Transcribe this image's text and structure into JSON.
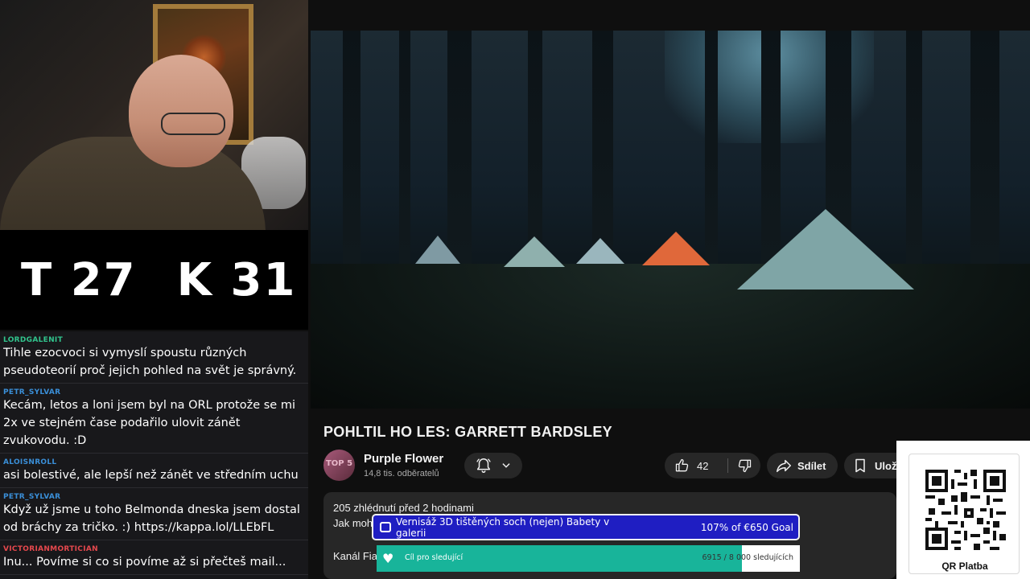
{
  "score": {
    "left": "T 27",
    "right": "K 31"
  },
  "chat": [
    {
      "user": "LORDGALENIT",
      "color": "#31c48d",
      "text": "Tihle ezocvoci si vymyslí spoustu různých pseudoteorií proč jejich pohled na svět je správný."
    },
    {
      "user": "PETR_SYLVAR",
      "color": "#3a8fd8",
      "text": "Kecám, letos a loni jsem byl na ORL protože se mi 2x ve stejném čase podařilo ulovit zánět zvukovodu. :D"
    },
    {
      "user": "ALOISNROLL",
      "color": "#3a8fd8",
      "text": "asi bolestivé, ale lepší než zánět ve středním uchu"
    },
    {
      "user": "PETR_SYLVAR",
      "color": "#3a8fd8",
      "text": "Když už jsme u toho Belmonda dneska jsem dostal od bráchy za tričko. :) https://kappa.lol/LLEbFL"
    },
    {
      "user": "VICTORIANMORTICIAN",
      "color": "#e5484d",
      "text": "Inu... Povíme si co si povíme až si přečteš mail..."
    }
  ],
  "video": {
    "title": "POHLTIL HO LES: GARRETT BARDSLEY",
    "channel_name": "Purple Flower",
    "subscribers": "14,8 tis. odběratelů",
    "avatar_text": "TOP 5",
    "likes": "42",
    "share_label": "Sdílet",
    "save_label": "Ulož",
    "views_date": "205 zhlédnutí  před 2 hodinami",
    "desc_line1": "Jak moh",
    "desc_line2": "Kanál Fia"
  },
  "goal": {
    "title": "Vernisáž 3D tištěných soch (nejen) Babety v galerii",
    "amount": "107% of €650 Goal",
    "color": "#1f1ec2"
  },
  "followers_goal": {
    "title": "Cíl pro sledující",
    "count": "6915 / 8 000 sledujících",
    "progress": 0.864,
    "color": "#18b49a"
  },
  "qr": {
    "label": "QR Platba"
  }
}
